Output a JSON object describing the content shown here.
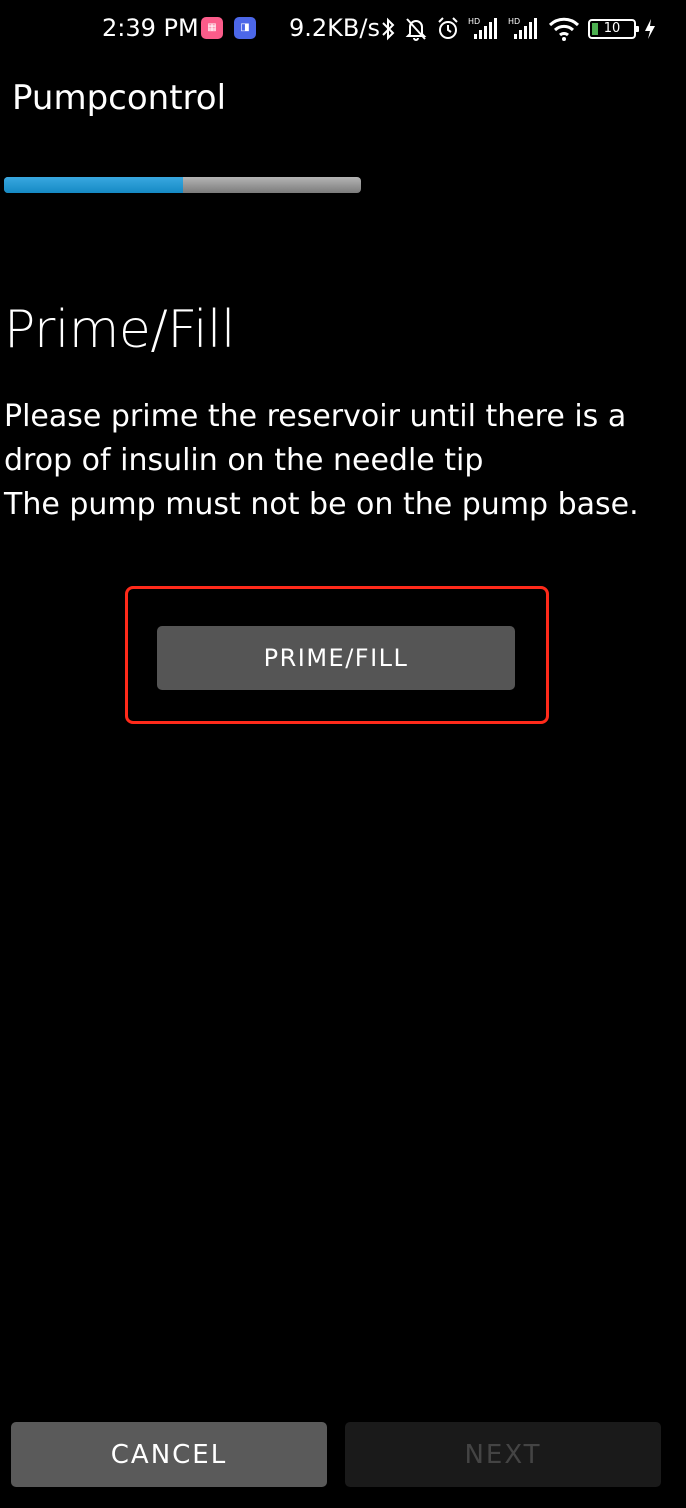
{
  "status_bar": {
    "time": "2:39 PM",
    "network_speed": "9.2KB/s",
    "battery_level": "10",
    "icons": [
      "app-icon-1",
      "app-icon-2",
      "bluetooth-icon",
      "mute-bell-icon",
      "alarm-icon",
      "signal-hd-1-icon",
      "signal-hd-2-icon",
      "wifi-icon",
      "battery-icon",
      "charging-icon"
    ]
  },
  "app_bar": {
    "title": "Pumpcontrol"
  },
  "progress": {
    "fraction": 0.5,
    "fill_color": "#1b95d1"
  },
  "main": {
    "heading": "Prime/Fill",
    "instructions": "Please prime the reservoir until there is a drop of insulin on the needle tip\nThe pump must not be on the pump base.",
    "prime_button_label": "PRIME/FILL"
  },
  "footer": {
    "cancel_label": "CANCEL",
    "next_label": "NEXT"
  },
  "colors": {
    "highlight": "#ff2a1a",
    "background": "#000000"
  }
}
